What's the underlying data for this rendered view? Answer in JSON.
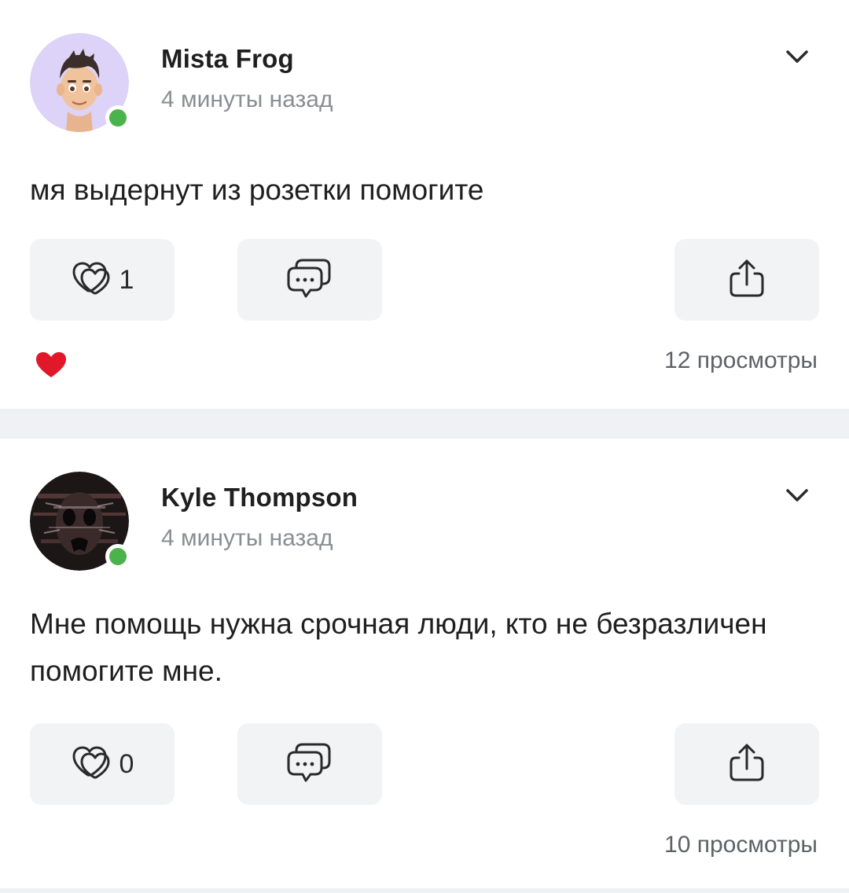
{
  "posts": [
    {
      "author": "Mista Frog",
      "time": "4 минуты назад",
      "text": "мя выдернут из розетки помогите",
      "likes": "1",
      "views": "12 просмотры",
      "avatar_icon": "memoji-avatar",
      "online": true,
      "has_reaction": true
    },
    {
      "author": "Kyle Thompson",
      "time": "4 минуты назад",
      "text": "Мне помощь нужна срочная люди, кто не безразличен помогите мне.",
      "likes": "0",
      "views": "10 просмотры",
      "avatar_icon": "dark-face-avatar",
      "online": true,
      "has_reaction": false
    }
  ],
  "colors": {
    "online": "#4bb34b",
    "reaction_heart": "#e0182a",
    "button_bg": "#f2f3f5",
    "separator": "#f0f1f4"
  }
}
